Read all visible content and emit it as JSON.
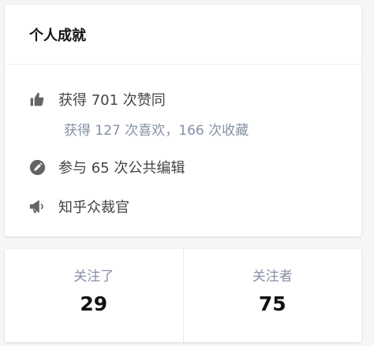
{
  "achievements": {
    "title": "个人成就",
    "likes": {
      "icon": "thumbs-up-icon",
      "text": "获得 701 次赞同",
      "sub_text": "获得 127 次喜欢，166 次收藏"
    },
    "edits": {
      "icon": "pencil-icon",
      "text": "参与 65 次公共编辑"
    },
    "moderator": {
      "icon": "megaphone-icon",
      "text": "知乎众裁官"
    }
  },
  "follow": {
    "following": {
      "label": "关注了",
      "count": "29"
    },
    "followers": {
      "label": "关注者",
      "count": "75"
    }
  }
}
